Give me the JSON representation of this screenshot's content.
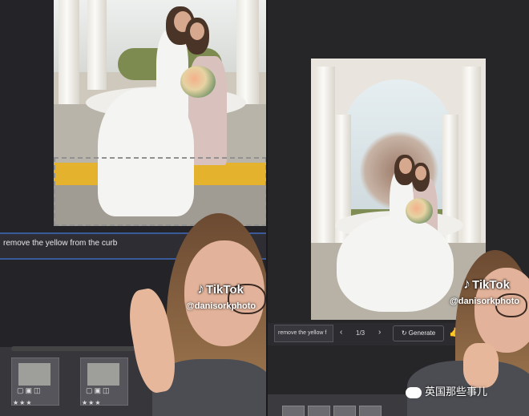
{
  "left_panel": {
    "prompt_text": "remove the yellow from the curb",
    "filmstrip": {
      "thumbnails": [
        {
          "stars": "★★★"
        },
        {
          "stars": "★★★"
        }
      ]
    },
    "tiktok": {
      "brand": "TikTok",
      "handle": "@danisorkphoto"
    }
  },
  "right_panel": {
    "generate_bar": {
      "prompt_text": "remove the yellow f",
      "prev_label": "‹",
      "page_indicator": "1/3",
      "next_label": "›",
      "generate_label": "Generate",
      "generate_icon": "↻"
    },
    "tiktok": {
      "brand": "TikTok",
      "handle": "@danisorkphoto"
    }
  },
  "watermark": {
    "text": "英国那些事儿",
    "icon": "wechat-icon"
  },
  "colors": {
    "selection_bar": "#3a5a9a",
    "curb_yellow": "#e4b22d",
    "panel_bg": "#232328"
  }
}
